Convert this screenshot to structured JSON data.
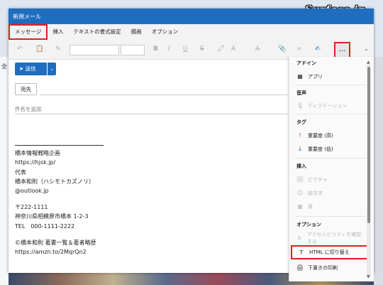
{
  "watermark": "Surface.jp",
  "background": {
    "left_glyph": "全"
  },
  "window": {
    "title": "新規メール"
  },
  "ribbon": {
    "tabs": [
      {
        "label": "メッセージ",
        "active": true
      },
      {
        "label": "挿入"
      },
      {
        "label": "テキストの書式設定"
      },
      {
        "label": "描画"
      },
      {
        "label": "オプション"
      }
    ]
  },
  "toolbar": {
    "more_label": "…"
  },
  "compose": {
    "send_label": "送信",
    "to_label": "宛先",
    "subject_placeholder": "件名を追加"
  },
  "signature": {
    "lines": [
      "橋本情報戦略企画",
      "https://hjsk.jp/",
      "代表",
      "橋本和則（ハシモトカズノリ）",
      "     @outlook.jp",
      "〒222-1111",
      "神奈川県相模原市橋本 1-2-3",
      "TEL　000-1111-2222",
      "©橋本和則 著書一覧＆著者略歴",
      "https://amzn.to/2MqrQn2"
    ]
  },
  "menu": {
    "sections": [
      {
        "heading": "アドイン",
        "items": [
          {
            "label": "アプリ",
            "icon": "apps-icon",
            "disabled": false
          }
        ]
      },
      {
        "heading": "音声",
        "items": [
          {
            "label": "ディクテーション",
            "icon": "microphone-icon",
            "disabled": true
          }
        ]
      },
      {
        "heading": "タグ",
        "items": [
          {
            "label": "重要度 (高)",
            "icon": "exclamation-icon",
            "disabled": false
          },
          {
            "label": "重要度 (低)",
            "icon": "down-arrow-icon",
            "disabled": false
          }
        ]
      },
      {
        "heading": "挿入",
        "items": [
          {
            "label": "ピクチャ",
            "icon": "picture-icon",
            "disabled": true
          },
          {
            "label": "絵文字",
            "icon": "emoji-icon",
            "disabled": true
          },
          {
            "label": "表",
            "icon": "table-icon",
            "disabled": true
          }
        ]
      },
      {
        "heading": "オプション",
        "items": [
          {
            "label": "アクセシビリティを確認する",
            "icon": "accessibility-icon",
            "disabled": true
          },
          {
            "label": "HTML に切り替え",
            "icon": "text-format-icon",
            "disabled": false,
            "highlighted": true
          },
          {
            "label": "下書きの印刷",
            "icon": "printer-icon",
            "disabled": false
          }
        ]
      }
    ]
  },
  "colors": {
    "accent": "#1f6dbf",
    "highlight_border": "#e02020"
  }
}
